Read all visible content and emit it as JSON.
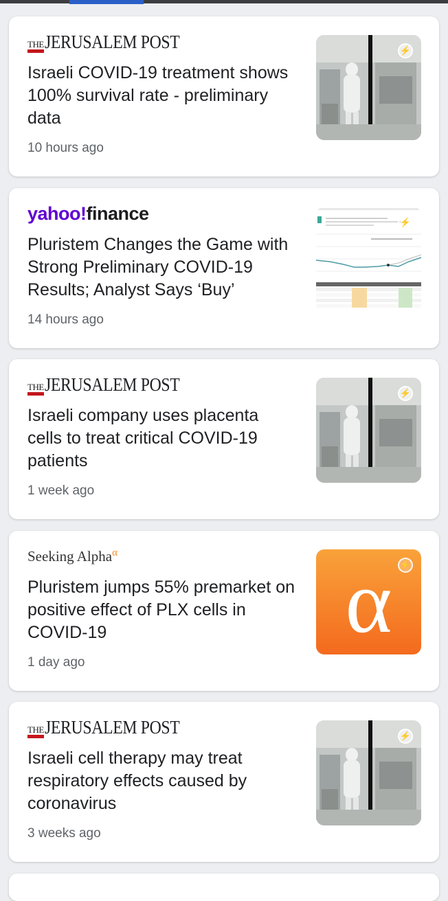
{
  "articles": [
    {
      "source": {
        "the": "THE",
        "name": "JERUSALEM POST"
      },
      "headline": "Israeli COVID-19 treatment shows 100% survival rate - preliminary data",
      "time": "10 hours ago",
      "thumbnail": "lab-photo"
    },
    {
      "source": {
        "part1": "yahoo",
        "bang": "!",
        "part2": "finance"
      },
      "headline": "Pluristem Changes the Game with Strong Preliminary COVID-19 Results; Analyst Says ‘Buy’",
      "time": "14 hours ago",
      "thumbnail": "stock-chart"
    },
    {
      "source": {
        "the": "THE",
        "name": "JERUSALEM POST"
      },
      "headline": "Israeli company uses placenta cells to treat critical COVID-19 patients",
      "time": "1 week ago",
      "thumbnail": "lab-photo"
    },
    {
      "source": {
        "name": "Seeking Alpha",
        "alpha": "α"
      },
      "headline": "Pluristem jumps 55% premarket on positive effect of PLX cells in COVID-19",
      "time": "1 day ago",
      "thumbnail": "alpha-logo",
      "thumb_glyph": "α"
    },
    {
      "source": {
        "the": "THE",
        "name": "JERUSALEM POST"
      },
      "headline": "Israeli cell therapy may treat respiratory effects caused by coronavirus",
      "time": "3 weeks ago",
      "thumbnail": "lab-photo"
    }
  ],
  "colors": {
    "background": "#eceef1",
    "jp_red": "#c4161c",
    "yahoo_purple": "#6001d2",
    "alpha_orange": "#f7861f"
  },
  "icons": {
    "amp": "lightning-bolt-icon"
  }
}
